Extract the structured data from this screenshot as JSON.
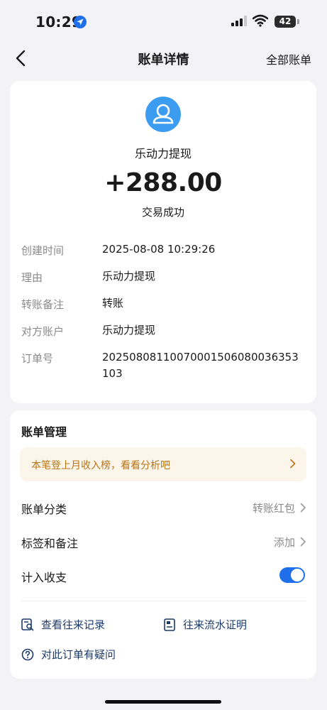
{
  "status_bar": {
    "time": "10:29",
    "battery": "42"
  },
  "nav": {
    "title": "账单详情",
    "right_link": "全部账单"
  },
  "detail": {
    "payee": "乐动力提现",
    "amount": "+288.00",
    "status": "交易成功",
    "fields": [
      {
        "label": "创建时间",
        "value": "2025-08-08 10:29:26"
      },
      {
        "label": "理由",
        "value": "乐动力提现"
      },
      {
        "label": "转账备注",
        "value": "转账"
      },
      {
        "label": "对方账户",
        "value": "乐动力提现"
      },
      {
        "label": "订单号",
        "value": "20250808110070001506080036353103"
      }
    ]
  },
  "manage": {
    "title": "账单管理",
    "banner": "本笔登上月收入榜，看看分析吧",
    "category": {
      "label": "账单分类",
      "value": "转账红包"
    },
    "tags": {
      "label": "标签和备注",
      "value": "添加"
    },
    "include": {
      "label": "计入收支",
      "on": true
    },
    "links": {
      "history": "查看往来记录",
      "proof": "往来流水证明",
      "question": "对此订单有疑问"
    }
  },
  "colors": {
    "accent": "#1f6fea",
    "avatar": "#3c9df0",
    "banner_bg": "#fcf6ea",
    "banner_text": "#b87418",
    "link_text": "#1b3a6b"
  }
}
